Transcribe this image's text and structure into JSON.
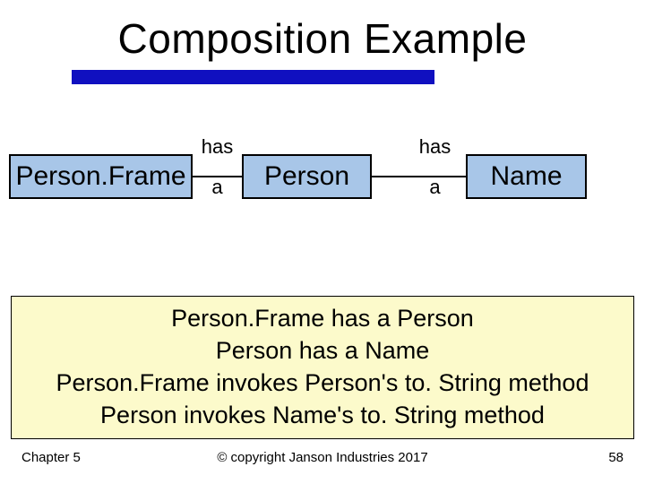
{
  "title": "Composition Example",
  "diagram": {
    "box1": "Person.Frame",
    "box2": "Person",
    "box3": "Name",
    "link1_top": "has",
    "link1_bottom": "a",
    "link2_top": "has",
    "link2_bottom": "a"
  },
  "body": {
    "line1": "Person.Frame has a Person",
    "line2": "Person has a Name",
    "line3": "Person.Frame invokes Person's to. String method",
    "line4": "Person invokes Name's to. String method"
  },
  "footer": {
    "left": "Chapter 5",
    "center": "© copyright Janson Industries 2017",
    "right": "58"
  }
}
